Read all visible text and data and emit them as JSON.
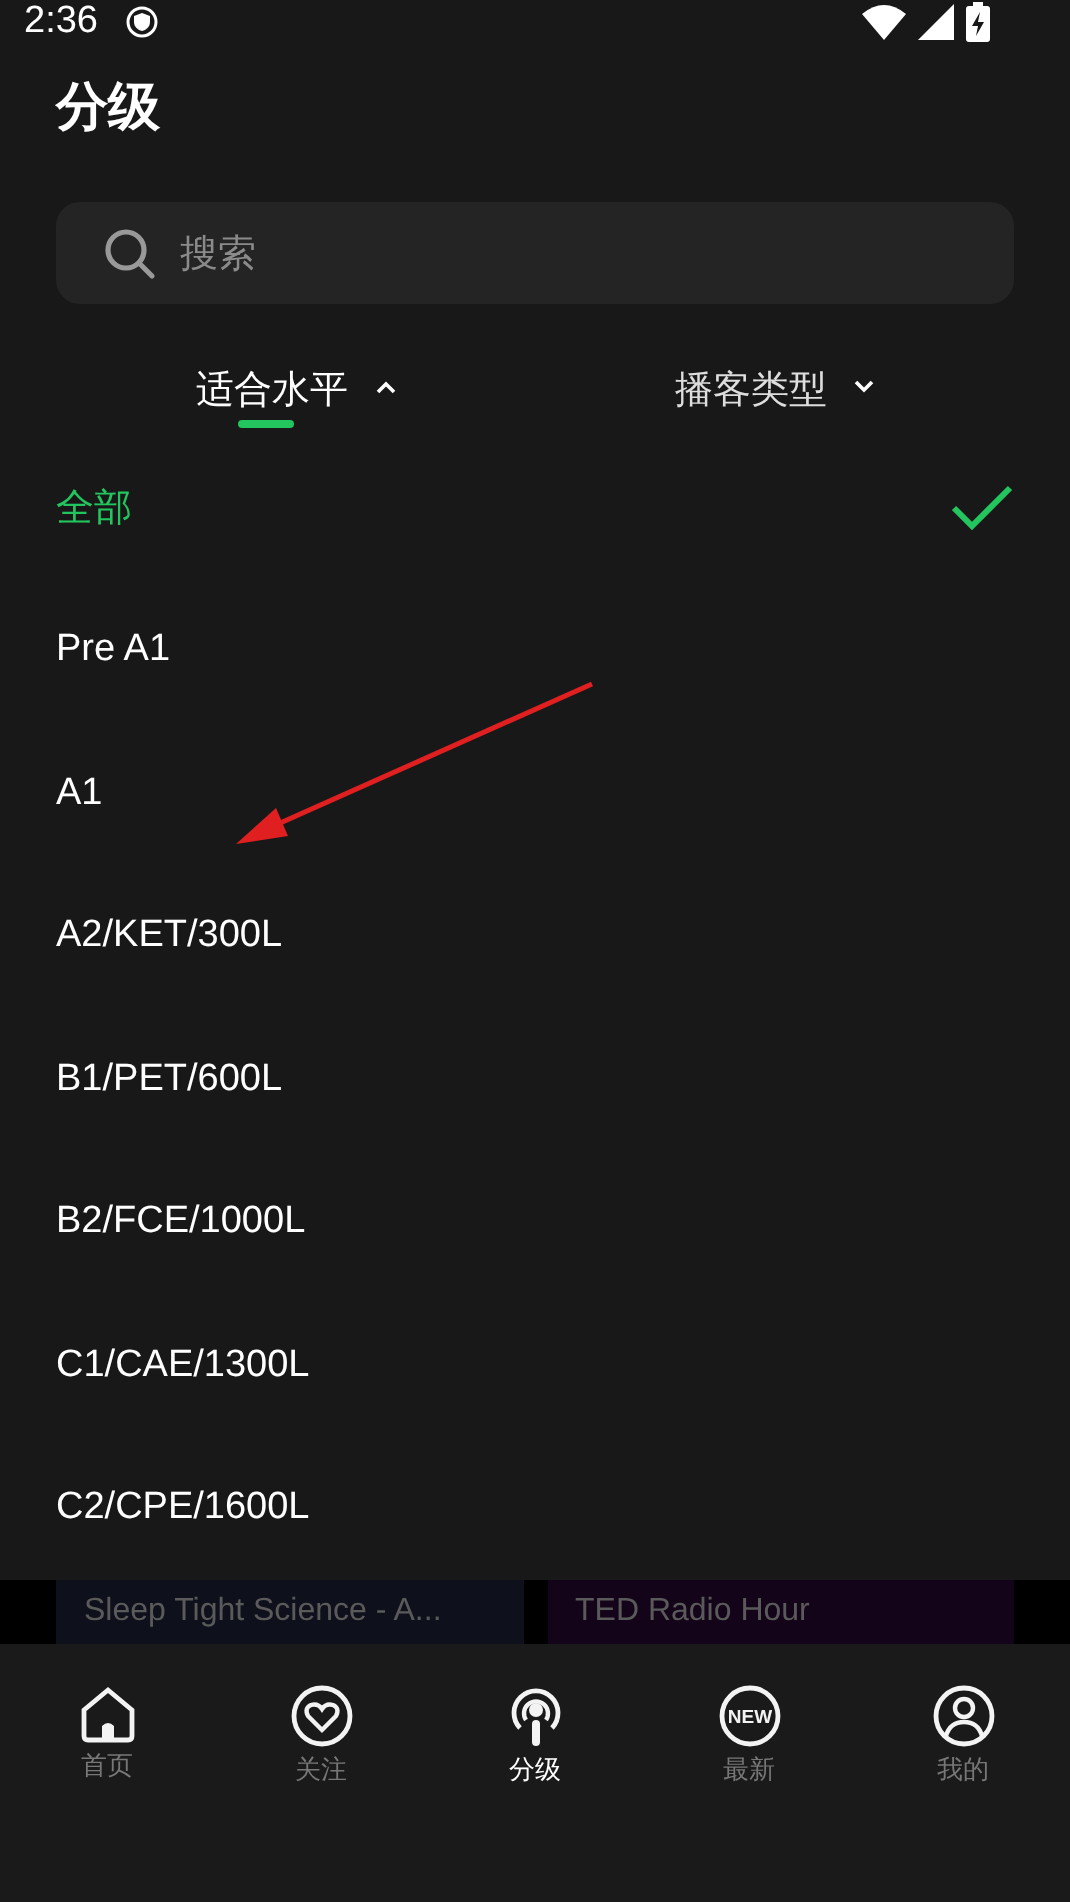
{
  "status_bar": {
    "time": "2:36"
  },
  "title": "分级",
  "search": {
    "placeholder": "搜索"
  },
  "filter_tabs": [
    {
      "label": "适合水平",
      "selected": true,
      "expanded": true
    },
    {
      "label": "播客类型",
      "selected": false,
      "expanded": false
    }
  ],
  "levels": [
    {
      "label": "全部",
      "selected": true
    },
    {
      "label": "Pre A1",
      "selected": false
    },
    {
      "label": "A1",
      "selected": false
    },
    {
      "label": "A2/KET/300L",
      "selected": false
    },
    {
      "label": "B1/PET/600L",
      "selected": false
    },
    {
      "label": "B2/FCE/1000L",
      "selected": false
    },
    {
      "label": "C1/CAE/1300L",
      "selected": false
    },
    {
      "label": "C2/CPE/1600L",
      "selected": false
    }
  ],
  "background_cards": [
    {
      "title": "Sleep Tight Science - A...",
      "color": "#0e111c"
    },
    {
      "title": "TED Radio Hour",
      "color": "#14041a"
    }
  ],
  "bottom_nav": [
    {
      "label": "首页",
      "kind": "home",
      "selected": false
    },
    {
      "label": "关注",
      "kind": "heart",
      "selected": false
    },
    {
      "label": "分级",
      "kind": "podcast",
      "selected": true
    },
    {
      "label": "最新",
      "kind": "new",
      "icon_text": "NEW",
      "selected": false
    },
    {
      "label": "我的",
      "kind": "user",
      "selected": false
    }
  ]
}
